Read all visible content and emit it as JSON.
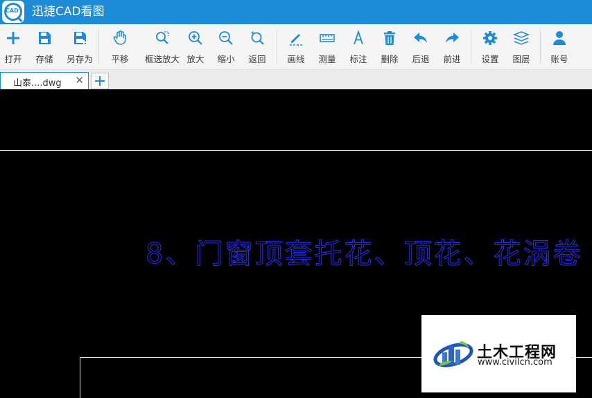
{
  "titlebar": {
    "title": "迅捷CAD看图",
    "logo_text": "CAD"
  },
  "toolbar": {
    "items": [
      {
        "label": "打开",
        "icon": "plus-icon"
      },
      {
        "label": "存储",
        "icon": "save-icon"
      },
      {
        "label": "另存为",
        "icon": "save-as-icon"
      },
      {
        "label": "平移",
        "icon": "hand-icon"
      },
      {
        "label": "框选放大",
        "icon": "box-zoom-icon"
      },
      {
        "label": "放大",
        "icon": "zoom-in-icon"
      },
      {
        "label": "缩小",
        "icon": "zoom-out-icon"
      },
      {
        "label": "返回",
        "icon": "return-zoom-icon"
      },
      {
        "label": "画线",
        "icon": "pencil-icon"
      },
      {
        "label": "测量",
        "icon": "ruler-icon"
      },
      {
        "label": "标注",
        "icon": "text-a-icon"
      },
      {
        "label": "删除",
        "icon": "trash-icon"
      },
      {
        "label": "后退",
        "icon": "undo-icon"
      },
      {
        "label": "前进",
        "icon": "redo-icon"
      },
      {
        "label": "设置",
        "icon": "gear-icon"
      },
      {
        "label": "图层",
        "icon": "layers-icon"
      },
      {
        "label": "账号",
        "icon": "user-icon"
      }
    ]
  },
  "tabs": {
    "active_label": "山泰....dwg",
    "close_glyph": "✕"
  },
  "drawing": {
    "text": "8、门窗顶套托花、顶花、花涡卷"
  },
  "watermark": {
    "name": "土木工程网",
    "url": "www.civilcn.com"
  },
  "colors": {
    "accent": "#1d8bd6",
    "cad_text": "#2b2bff",
    "canvas": "#000000"
  }
}
